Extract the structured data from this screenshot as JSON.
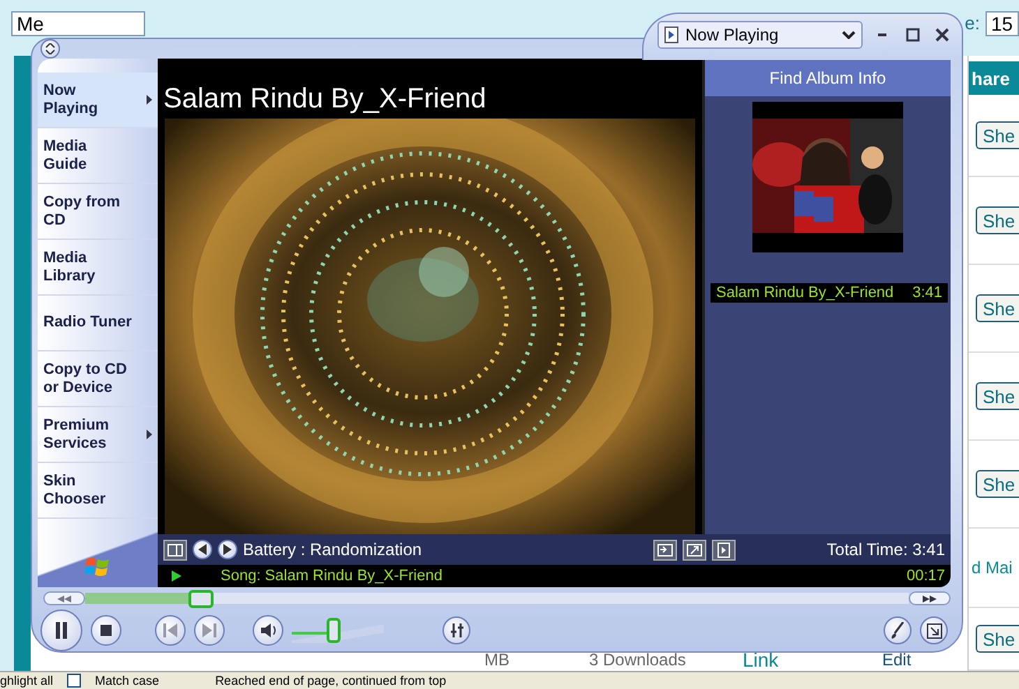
{
  "page": {
    "search_value": "Me",
    "page_label": "e:",
    "page_value": "15",
    "share_heading": "hare",
    "share_buttons": [
      "She",
      "She",
      "She",
      "She",
      "She"
    ],
    "mail_link": "d Mai",
    "downloads_row": {
      "size": "MB",
      "downloads": "3 Downloads",
      "link": "Link",
      "edit": "Edit",
      "share": "She"
    }
  },
  "find_bar": {
    "highlight": "ghlight all",
    "match_case": {
      "label": "Match case",
      "checked": false
    },
    "status": "Reached end of page, continued from top"
  },
  "player": {
    "mode_menu": "Now Playing",
    "nav": [
      {
        "label": "Now Playing",
        "selected": true,
        "submenu": true
      },
      {
        "label": "Media Guide",
        "selected": false,
        "submenu": false
      },
      {
        "label": "Copy from CD",
        "selected": false,
        "submenu": false
      },
      {
        "label": "Media Library",
        "selected": false,
        "submenu": false
      },
      {
        "label": "Radio Tuner",
        "selected": false,
        "submenu": false
      },
      {
        "label": "Copy to CD or Device",
        "selected": false,
        "submenu": false
      },
      {
        "label": "Premium Services",
        "selected": false,
        "submenu": true
      },
      {
        "label": "Skin Chooser",
        "selected": false,
        "submenu": false
      }
    ],
    "video_title": "Salam Rindu By_X-Friend",
    "visualization": "Battery : Randomization",
    "find_album": "Find Album Info",
    "playlist": [
      {
        "title": "Salam Rindu By_X-Friend",
        "duration": "3:41",
        "selected": true
      }
    ],
    "total_time": "Total Time: 3:41",
    "song": "Song: Salam Rindu By_X-Friend",
    "elapsed": "00:17",
    "seek": {
      "level": 0.14
    },
    "volume": {
      "level": 0.45
    }
  }
}
